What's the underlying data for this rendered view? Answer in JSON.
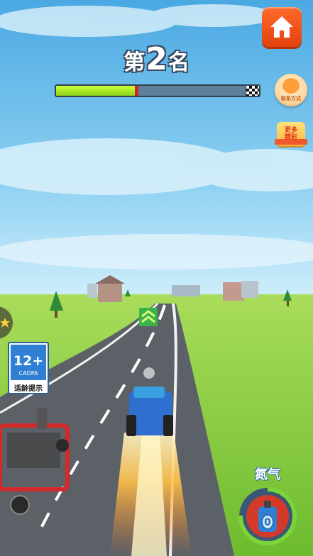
{
  "hud": {
    "rank_prefix": "第",
    "rank_number": "2",
    "rank_suffix": "名",
    "race_progress": 0.4
  },
  "buttons": {
    "home_icon": "home-icon",
    "contact_label": "联系方式",
    "more_label_line1": "更多",
    "more_label_line2": "精彩"
  },
  "age_rating": {
    "age": "12+",
    "org": "CADPA",
    "tip": "适龄提示"
  },
  "nitro": {
    "label": "氮气",
    "count": "0"
  },
  "colors": {
    "sky": "#5fb8e6",
    "grass": "#7cc43a",
    "road": "#5a5f66",
    "home_button": "#f0561a",
    "progress_fill": "#a8e82a",
    "nitro_ring": "#7ad43a"
  }
}
